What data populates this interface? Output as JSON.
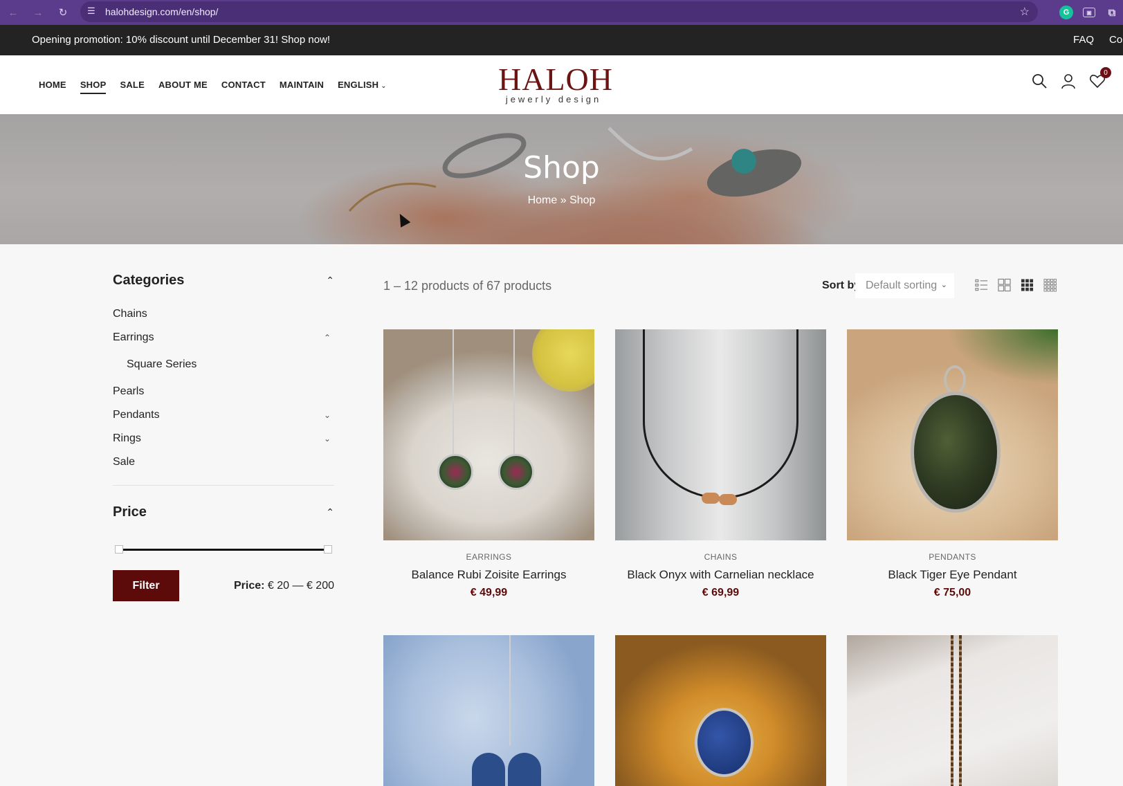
{
  "browser": {
    "url": "halohdesign.com/en/shop/",
    "back_icon": "arrow-left-icon",
    "forward_icon": "arrow-right-icon",
    "reload_icon": "reload-icon"
  },
  "promo": {
    "text": "Opening promotion: 10% discount until December 31! Shop now!",
    "links": [
      "FAQ",
      "Cor"
    ]
  },
  "header": {
    "nav": [
      "HOME",
      "SHOP",
      "SALE",
      "ABOUT ME",
      "CONTACT",
      "MAINTAIN",
      "ENGLISH"
    ],
    "active_nav": "SHOP",
    "logo_main": "HALOH",
    "logo_sub": "jewerly design",
    "wishlist_count": "0"
  },
  "hero": {
    "title": "Shop",
    "breadcrumb_home": "Home",
    "breadcrumb_sep": "»",
    "breadcrumb_current": "Shop"
  },
  "sidebar": {
    "categories_title": "Categories",
    "categories": [
      {
        "label": "Chains"
      },
      {
        "label": "Earrings"
      },
      {
        "label": "Square Series"
      },
      {
        "label": "Pearls"
      },
      {
        "label": "Pendants"
      },
      {
        "label": "Rings"
      },
      {
        "label": "Sale"
      }
    ],
    "price_title": "Price",
    "price_range_min": 20,
    "price_range_max": 200,
    "filter_label": "Filter",
    "price_label": "Price:",
    "price_value": "€ 20 — € 200"
  },
  "toolbar": {
    "result_count": "1 – 12 products of 67 products",
    "sort_label": "Sort by",
    "sort_value": "Default sorting"
  },
  "products": [
    {
      "category": "EARRINGS",
      "title": "Balance Rubi Zoisite Earrings",
      "price": "€ 49,99"
    },
    {
      "category": "CHAINS",
      "title": "Black Onyx with Carnelian necklace",
      "price": "€ 69,99"
    },
    {
      "category": "PENDANTS",
      "title": "Black Tiger Eye Pendant",
      "price": "€ 75,00"
    },
    {
      "category": "",
      "title": "",
      "price": ""
    },
    {
      "category": "",
      "title": "",
      "price": ""
    },
    {
      "category": "",
      "title": "",
      "price": ""
    }
  ],
  "colors": {
    "brand": "#5c0a0a",
    "promo_bg": "#232323",
    "browser_bg": "#5b3c8c"
  }
}
